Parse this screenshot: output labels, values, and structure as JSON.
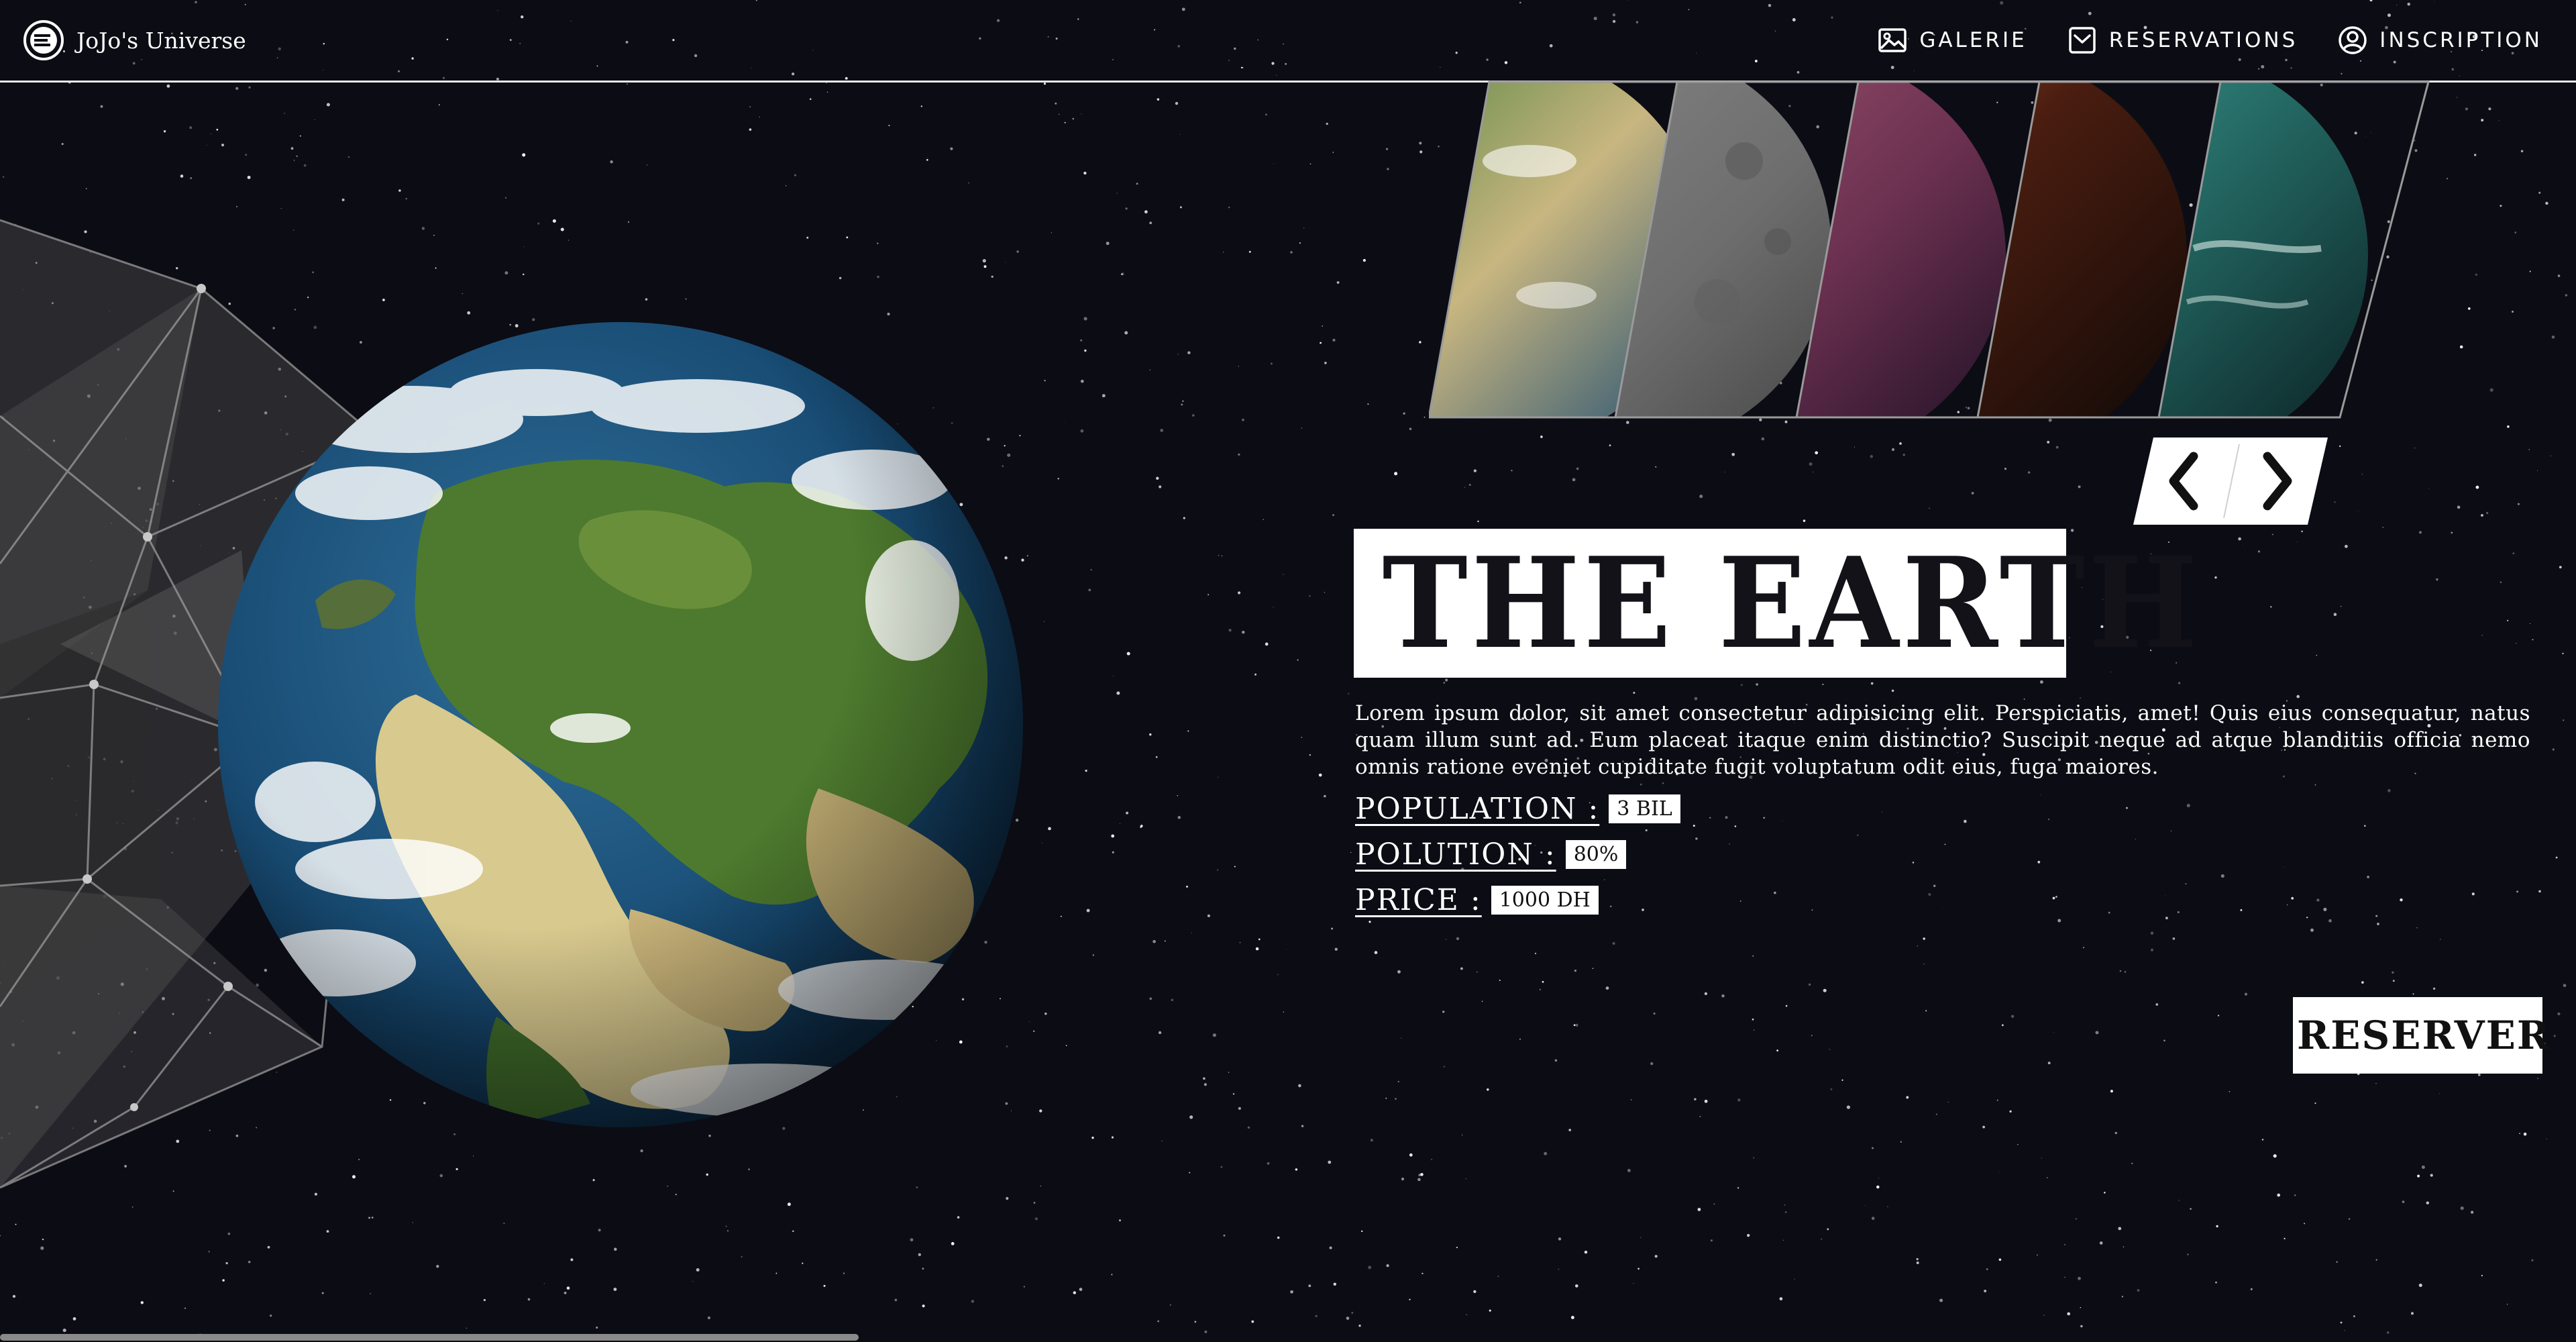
{
  "app": {
    "name": "JoJo's Universe",
    "logo_icon": "jojo-logo-icon"
  },
  "nav": {
    "items": [
      {
        "label": "GALERIE",
        "icon": "image-icon"
      },
      {
        "label": "RESERVATIONS",
        "icon": "bookmark-inbox-icon"
      },
      {
        "label": "INSCRIPTION",
        "icon": "user-circle-icon"
      }
    ]
  },
  "carousel": {
    "thumbnails": [
      "earth",
      "moon",
      "red-planet",
      "mars",
      "teal-planet"
    ],
    "selected": "earth",
    "prev_icon": "chevron-left-icon",
    "next_icon": "chevron-right-icon"
  },
  "planet": {
    "title": "THE EARTH",
    "description": "Lorem ipsum dolor, sit amet consectetur adipisicing elit. Perspiciatis, amet! Quis eius consequatur, natus quam illum sunt ad. Eum placeat itaque enim distinctio? Suscipit neque ad atque blanditiis officia nemo omnis ratione eveniet cupiditate fugit voluptatum odit eius, fuga maiores.",
    "stats": [
      {
        "label": "POPULATION :",
        "value": "3 BIL"
      },
      {
        "label": "POLUTION :",
        "value": "80%"
      },
      {
        "label": "PRICE :",
        "value": "1000 DH"
      }
    ]
  },
  "actions": {
    "reserve_label": "RESERVER"
  },
  "colors": {
    "background": "#0c0c14",
    "accent": "#ffffff",
    "title_text": "#121218"
  }
}
